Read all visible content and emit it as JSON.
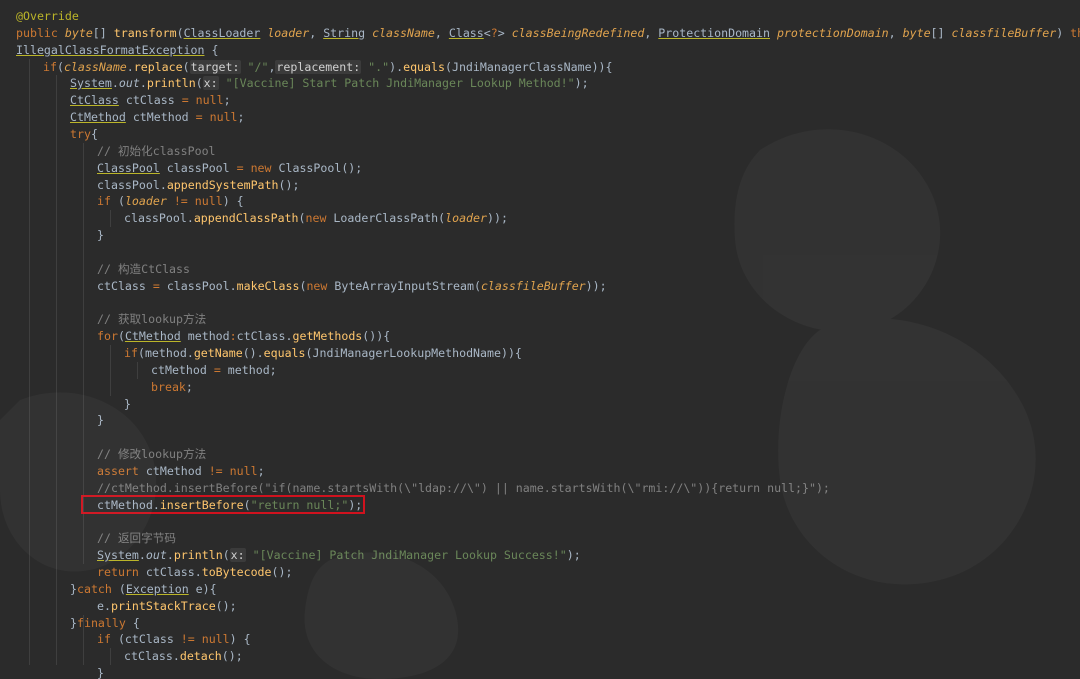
{
  "app": "IDE code editor",
  "theme": {
    "background": "#2b2b2b",
    "highlight_box": "#d0121e",
    "keyword": "#cc7832",
    "string": "#6a8759",
    "method": "#ffc66d",
    "comment": "#808080"
  },
  "highlighted_line": "ctMethod.insertBefore(\"return null;\");",
  "lines": [
    {
      "indent": 0,
      "tokens": [
        [
          "ann",
          "@Override"
        ]
      ]
    },
    {
      "indent": 0,
      "tokens": [
        [
          "kw",
          "public "
        ],
        [
          "po",
          "byte"
        ],
        [
          "id",
          "[] "
        ],
        [
          "sr",
          "transform"
        ],
        [
          "id",
          "("
        ],
        [
          "ty",
          "ClassLoader"
        ],
        [
          "id",
          " "
        ],
        [
          "po",
          "loader"
        ],
        [
          "id",
          ", "
        ],
        [
          "ty",
          "String"
        ],
        [
          "id",
          " "
        ],
        [
          "po",
          "className"
        ],
        [
          "id",
          ", "
        ],
        [
          "ty",
          "Class"
        ],
        [
          "id",
          "<"
        ],
        [
          "kw",
          "?"
        ],
        [
          "id",
          "> "
        ],
        [
          "po",
          "classBeingRedefined"
        ],
        [
          "id",
          ", "
        ],
        [
          "ty",
          "ProtectionDomain"
        ],
        [
          "id",
          " "
        ],
        [
          "po",
          "protectionDomain"
        ],
        [
          "id",
          ", "
        ],
        [
          "po",
          "byte"
        ],
        [
          "id",
          "[] "
        ],
        [
          "po",
          "classfileBuffer"
        ],
        [
          "id",
          ") "
        ],
        [
          "kw",
          "throws"
        ]
      ]
    },
    {
      "indent": 0,
      "tokens": [
        [
          "ty",
          "IllegalClassFormatException"
        ],
        [
          "id",
          " {"
        ]
      ]
    },
    {
      "indent": 1,
      "tokens": [
        [
          "kw",
          "if"
        ],
        [
          "id",
          "("
        ],
        [
          "po",
          "className"
        ],
        [
          "id",
          "."
        ],
        [
          "sr",
          "replace"
        ],
        [
          "id",
          "("
        ],
        [
          "hint",
          "target:"
        ],
        [
          "id",
          " "
        ],
        [
          "st",
          "\"/\""
        ],
        [
          "id",
          ","
        ],
        [
          "hint",
          "replacement:"
        ],
        [
          "id",
          " "
        ],
        [
          "st",
          "\".\""
        ],
        [
          "id",
          ")."
        ],
        [
          "sr",
          "equals"
        ],
        [
          "id",
          "(JndiManagerClassName)){"
        ]
      ]
    },
    {
      "indent": 2,
      "tokens": [
        [
          "ty",
          "System"
        ],
        [
          "id",
          "."
        ],
        [
          "pi",
          "out"
        ],
        [
          "id",
          "."
        ],
        [
          "sr",
          "println"
        ],
        [
          "id",
          "("
        ],
        [
          "hint",
          "x:"
        ],
        [
          "id",
          " "
        ],
        [
          "st",
          "\"[Vaccine] Start Patch JndiManager Lookup Method!\""
        ],
        [
          "id",
          ");"
        ]
      ]
    },
    {
      "indent": 2,
      "tokens": [
        [
          "ty",
          "CtClass"
        ],
        [
          "id",
          " ctClass "
        ],
        [
          "kw",
          "= null"
        ],
        [
          "id",
          ";"
        ]
      ]
    },
    {
      "indent": 2,
      "tokens": [
        [
          "ty",
          "CtMethod"
        ],
        [
          "id",
          " ctMethod "
        ],
        [
          "kw",
          "= null"
        ],
        [
          "id",
          ";"
        ]
      ]
    },
    {
      "indent": 2,
      "tokens": [
        [
          "kw",
          "try"
        ],
        [
          "id",
          "{"
        ]
      ]
    },
    {
      "indent": 3,
      "tokens": [
        [
          "cm",
          "// 初始化classPool"
        ]
      ]
    },
    {
      "indent": 3,
      "tokens": [
        [
          "ty",
          "ClassPool"
        ],
        [
          "id",
          " classPool "
        ],
        [
          "kw",
          "= new "
        ],
        [
          "id",
          "ClassPool();"
        ]
      ]
    },
    {
      "indent": 3,
      "tokens": [
        [
          "id",
          "classPool."
        ],
        [
          "sr",
          "appendSystemPath"
        ],
        [
          "id",
          "();"
        ]
      ]
    },
    {
      "indent": 3,
      "tokens": [
        [
          "kw",
          "if "
        ],
        [
          "id",
          "("
        ],
        [
          "po",
          "loader"
        ],
        [
          "id",
          " "
        ],
        [
          "kw",
          "!= null"
        ],
        [
          "id",
          ") {"
        ]
      ]
    },
    {
      "indent": 4,
      "tokens": [
        [
          "id",
          "classPool."
        ],
        [
          "sr",
          "appendClassPath"
        ],
        [
          "id",
          "("
        ],
        [
          "kw",
          "new "
        ],
        [
          "id",
          "LoaderClassPath("
        ],
        [
          "po",
          "loader"
        ],
        [
          "id",
          "));"
        ]
      ]
    },
    {
      "indent": 3,
      "tokens": [
        [
          "id",
          "}"
        ]
      ]
    },
    {
      "indent": 3,
      "tokens": []
    },
    {
      "indent": 3,
      "tokens": [
        [
          "cm",
          "// 构造CtClass"
        ]
      ]
    },
    {
      "indent": 3,
      "tokens": [
        [
          "id",
          "ctClass "
        ],
        [
          "kw",
          "= "
        ],
        [
          "id",
          "classPool."
        ],
        [
          "sr",
          "makeClass"
        ],
        [
          "id",
          "("
        ],
        [
          "kw",
          "new "
        ],
        [
          "id",
          "ByteArrayInputStream("
        ],
        [
          "po",
          "classfileBuffer"
        ],
        [
          "id",
          "));"
        ]
      ]
    },
    {
      "indent": 3,
      "tokens": []
    },
    {
      "indent": 3,
      "tokens": [
        [
          "cm",
          "// 获取lookup方法"
        ]
      ]
    },
    {
      "indent": 3,
      "tokens": [
        [
          "kw",
          "for"
        ],
        [
          "id",
          "("
        ],
        [
          "ty",
          "CtMethod"
        ],
        [
          "id",
          " method"
        ],
        [
          "kw",
          ":"
        ],
        [
          "id",
          "ctClass."
        ],
        [
          "sr",
          "getMethods"
        ],
        [
          "id",
          "()){"
        ]
      ]
    },
    {
      "indent": 4,
      "tokens": [
        [
          "kw",
          "if"
        ],
        [
          "id",
          "(method."
        ],
        [
          "sr",
          "getName"
        ],
        [
          "id",
          "()."
        ],
        [
          "sr",
          "equals"
        ],
        [
          "id",
          "(JndiManagerLookupMethodName)){"
        ]
      ]
    },
    {
      "indent": 5,
      "tokens": [
        [
          "id",
          "ctMethod "
        ],
        [
          "kw",
          "= "
        ],
        [
          "id",
          "method;"
        ]
      ]
    },
    {
      "indent": 5,
      "tokens": [
        [
          "kw",
          "break"
        ],
        [
          "id",
          ";"
        ]
      ]
    },
    {
      "indent": 4,
      "tokens": [
        [
          "id",
          "}"
        ]
      ]
    },
    {
      "indent": 3,
      "tokens": [
        [
          "id",
          "}"
        ]
      ]
    },
    {
      "indent": 3,
      "tokens": []
    },
    {
      "indent": 3,
      "tokens": [
        [
          "cm",
          "// 修改lookup方法"
        ]
      ]
    },
    {
      "indent": 3,
      "tokens": [
        [
          "kw",
          "assert "
        ],
        [
          "id",
          "ctMethod "
        ],
        [
          "kw",
          "!= null"
        ],
        [
          "id",
          ";"
        ]
      ]
    },
    {
      "indent": 3,
      "tokens": [
        [
          "cm",
          "//ctMethod.insertBefore(\"if(name.startsWith(\\\"ldap://\\\") || name.startsWith(\\\"rmi://\\\")){return null;}\");"
        ]
      ]
    },
    {
      "indent": 3,
      "tokens": [
        [
          "id",
          "ctMethod."
        ],
        [
          "sr",
          "insertBefore"
        ],
        [
          "id",
          "("
        ],
        [
          "st",
          "\"return null;\""
        ],
        [
          "id",
          ");"
        ]
      ]
    },
    {
      "indent": 3,
      "tokens": []
    },
    {
      "indent": 3,
      "tokens": [
        [
          "cm",
          "// 返回字节码"
        ]
      ]
    },
    {
      "indent": 3,
      "tokens": [
        [
          "ty",
          "System"
        ],
        [
          "id",
          "."
        ],
        [
          "pi",
          "out"
        ],
        [
          "id",
          "."
        ],
        [
          "sr",
          "println"
        ],
        [
          "id",
          "("
        ],
        [
          "hint",
          "x:"
        ],
        [
          "id",
          " "
        ],
        [
          "st",
          "\"[Vaccine] Patch JndiManager Lookup Success!\""
        ],
        [
          "id",
          ");"
        ]
      ]
    },
    {
      "indent": 3,
      "tokens": [
        [
          "kw",
          "return "
        ],
        [
          "id",
          "ctClass."
        ],
        [
          "sr",
          "toBytecode"
        ],
        [
          "id",
          "();"
        ]
      ]
    },
    {
      "indent": 2,
      "tokens": [
        [
          "id",
          "}"
        ],
        [
          "kw",
          "catch "
        ],
        [
          "id",
          "("
        ],
        [
          "ty",
          "Exception"
        ],
        [
          "id",
          " e){"
        ]
      ]
    },
    {
      "indent": 3,
      "tokens": [
        [
          "id",
          "e."
        ],
        [
          "sr",
          "printStackTrace"
        ],
        [
          "id",
          "();"
        ]
      ]
    },
    {
      "indent": 2,
      "tokens": [
        [
          "id",
          "}"
        ],
        [
          "kw",
          "finally "
        ],
        [
          "id",
          "{"
        ]
      ]
    },
    {
      "indent": 3,
      "tokens": [
        [
          "kw",
          "if "
        ],
        [
          "id",
          "(ctClass "
        ],
        [
          "kw",
          "!= null"
        ],
        [
          "id",
          ") {"
        ]
      ]
    },
    {
      "indent": 4,
      "tokens": [
        [
          "id",
          "ctClass."
        ],
        [
          "sr",
          "detach"
        ],
        [
          "id",
          "();"
        ]
      ]
    },
    {
      "indent": 3,
      "tokens": [
        [
          "id",
          "}"
        ]
      ]
    }
  ]
}
